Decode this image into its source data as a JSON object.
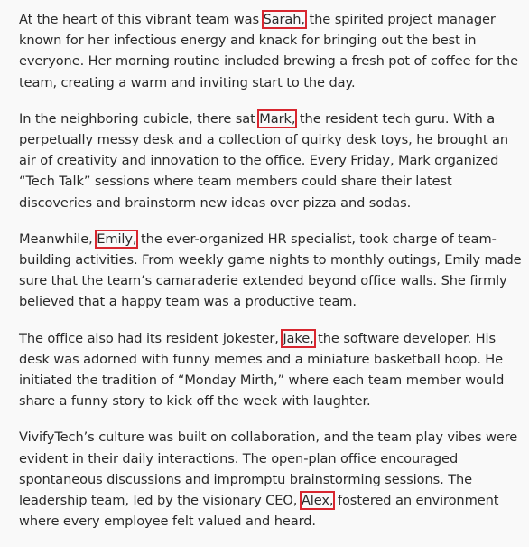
{
  "paragraphs": [
    {
      "before": "At the heart of this vibrant team was ",
      "name": "Sarah,",
      "after": " the spirited project manager known for her infectious energy and knack for bringing out the best in everyone. Her morning routine included brewing a fresh pot of coffee for the team, creating a warm and inviting start to the day."
    },
    {
      "before": "In the neighboring cubicle, there sat ",
      "name": "Mark,",
      "after": " the resident tech guru. With a perpetually messy desk and a collection of quirky desk toys, he brought an air of creativity and innovation to the office. Every Friday, Mark organized “Tech Talk” sessions where team members could share their latest discoveries and brainstorm new ideas over pizza and sodas."
    },
    {
      "before": "Meanwhile, ",
      "name": "Emily,",
      "after": " the ever-organized HR specialist, took charge of team-building activities. From weekly game nights to monthly outings, Emily made sure that the team’s camaraderie extended beyond office walls. She firmly believed that a happy team was a productive team."
    },
    {
      "before": "The office also had its resident jokester, ",
      "name": "Jake,",
      "after": " the software developer. His desk was adorned with funny memes and a miniature basketball hoop. He initiated the tradition of “Monday Mirth,” where each team member would share a funny story to kick off the week with laughter."
    },
    {
      "before": "VivifyTech’s culture was built on collaboration, and the team play vibes were evident in their daily interactions. The open-plan office encouraged spontaneous discussions and impromptu brainstorming sessions. The leadership team, led by the visionary CEO, ",
      "name": "Alex,",
      "after": " fostered an environment where every employee felt valued and heard."
    }
  ]
}
